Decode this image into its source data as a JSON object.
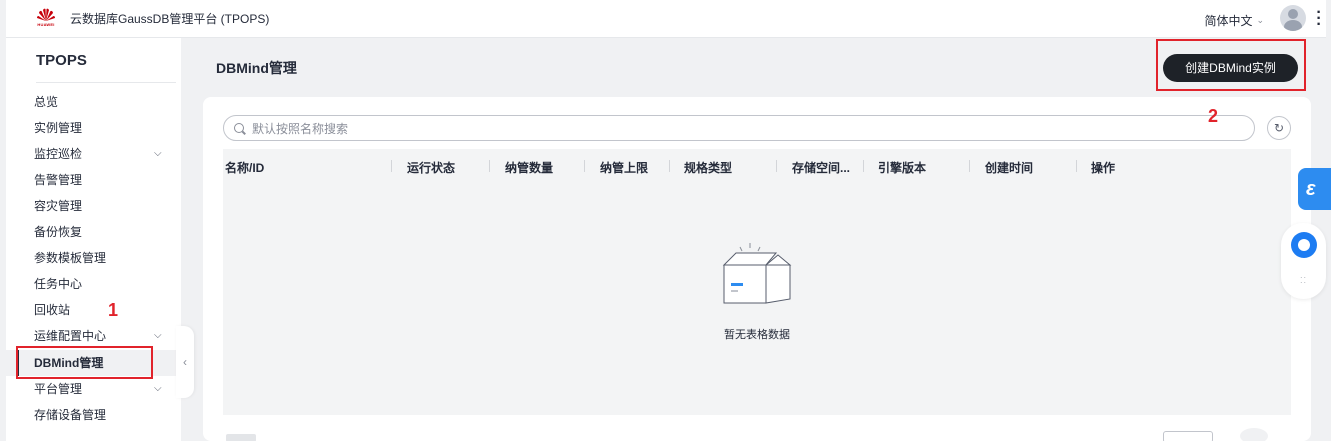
{
  "header": {
    "brand": "HUAWEI",
    "app_title": "云数据库GaussDB管理平台 (TPOPS)",
    "language": "简体中文",
    "more_icon": "more-vertical-icon"
  },
  "sidebar": {
    "title": "TPOPS",
    "items": [
      {
        "label": "总览"
      },
      {
        "label": "实例管理"
      },
      {
        "label": "监控巡检"
      },
      {
        "label": "告警管理"
      },
      {
        "label": "容灾管理"
      },
      {
        "label": "备份恢复"
      },
      {
        "label": "参数模板管理"
      },
      {
        "label": "任务中心"
      },
      {
        "label": "回收站"
      },
      {
        "label": "运维配置中心"
      },
      {
        "label": "DBMind管理"
      },
      {
        "label": "平台管理"
      },
      {
        "label": "存储设备管理"
      }
    ]
  },
  "main": {
    "page_title": "DBMind管理",
    "create_button": "创建DBMind实例",
    "search_placeholder": "默认按照名称搜索",
    "table": {
      "columns": [
        "名称/ID",
        "运行状态",
        "纳管数量",
        "纳管上限",
        "规格类型",
        "存储空间...",
        "引擎版本",
        "创建时间",
        "操作"
      ],
      "rows": [],
      "empty_text": "暂无表格数据"
    }
  },
  "annotations": {
    "marker_1": "1",
    "marker_2": "2",
    "color": "#e1232b"
  },
  "colors": {
    "brand_red": "#c7000b",
    "primary_button": "#1e2228",
    "float_blue": "#2d8cf0"
  }
}
